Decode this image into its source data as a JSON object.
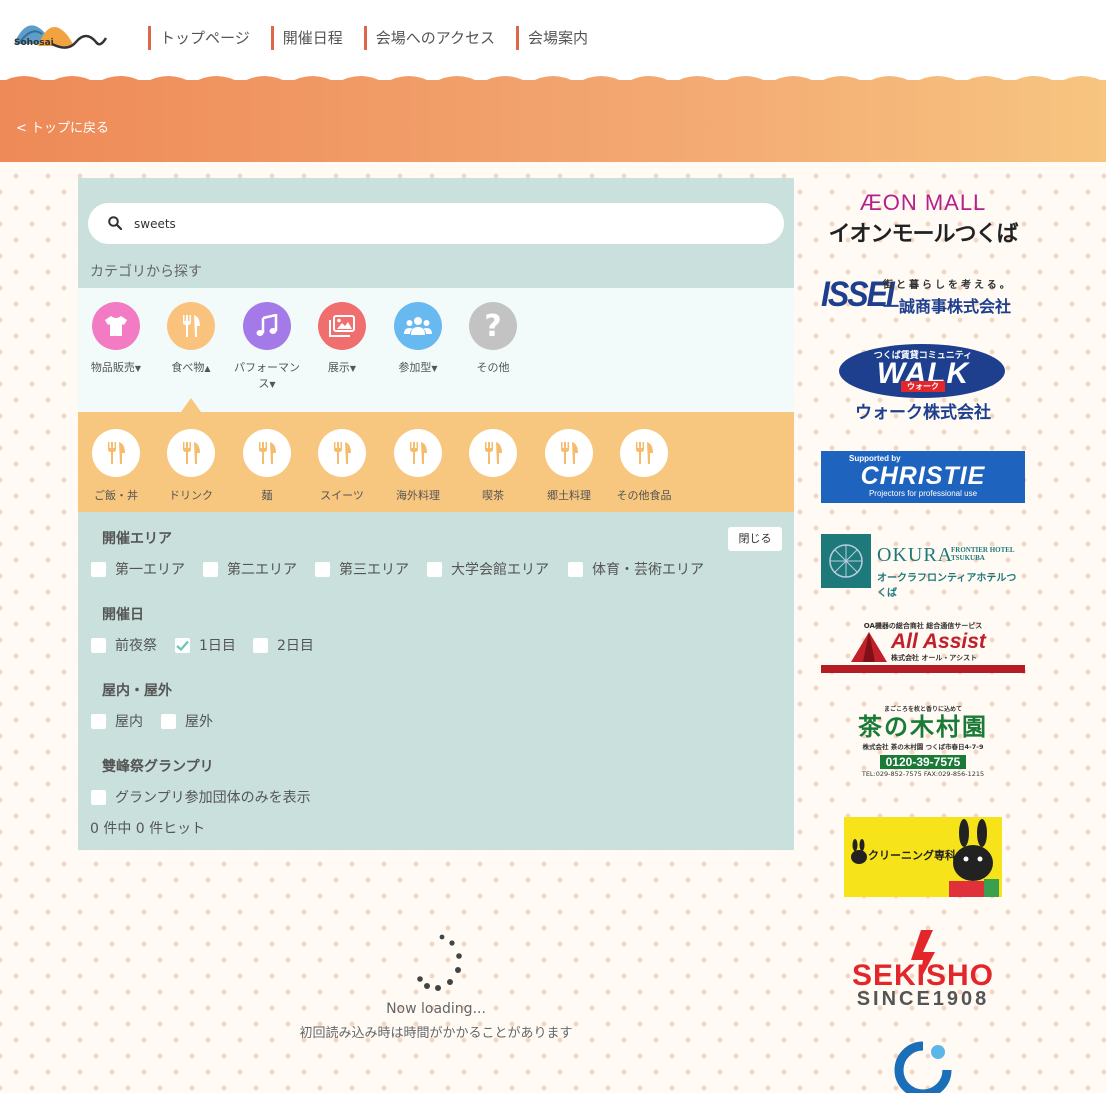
{
  "header": {
    "logo_text": "Sohosai",
    "nav": [
      "トップページ",
      "開催日程",
      "会場へのアクセス",
      "会場案内"
    ]
  },
  "banner": {
    "back_link": "< トップに戻る"
  },
  "search": {
    "value": "sweets"
  },
  "categories": {
    "heading": "カテゴリから探す",
    "items": [
      {
        "label": "物品販売",
        "color": "#f27bc4",
        "icon": "tshirt-icon"
      },
      {
        "label": "食べ物",
        "color": "#f9c37d",
        "icon": "utensils-icon"
      },
      {
        "label": "パフォーマンス",
        "color": "#a47ae8",
        "icon": "music-note-icon"
      },
      {
        "label": "展示",
        "color": "#f06e6e",
        "icon": "images-icon"
      },
      {
        "label": "参加型",
        "color": "#69b9f1",
        "icon": "people-icon"
      },
      {
        "label": "その他",
        "color": "#c3c3c3",
        "icon": "question-icon"
      }
    ],
    "sub_items": [
      "ご飯・丼",
      "ドリンク",
      "麺",
      "スイーツ",
      "海外料理",
      "喫茶",
      "郷土料理",
      "その他食品"
    ]
  },
  "filters": {
    "close_label": "閉じる",
    "area": {
      "title": "開催エリア",
      "options": [
        "第一エリア",
        "第二エリア",
        "第三エリア",
        "大学会館エリア",
        "体育・芸術エリア"
      ]
    },
    "date": {
      "title": "開催日",
      "options": [
        {
          "label": "前夜祭",
          "checked": false
        },
        {
          "label": "1日目",
          "checked": true
        },
        {
          "label": "2日目",
          "checked": false
        }
      ]
    },
    "place": {
      "title": "屋内・屋外",
      "options": [
        "屋内",
        "屋外"
      ]
    },
    "grandprix": {
      "title": "雙峰祭グランプリ",
      "option": "グランプリ参加団体のみを表示"
    }
  },
  "hits": "0 件中 0 件ヒット",
  "loading": {
    "text": "Now loading...",
    "note": "初回読み込み時は時間がかかることがあります"
  },
  "sponsors": {
    "aeon": {
      "line1": "ÆON MALL",
      "line2": "イオンモールつくば"
    },
    "issei": {
      "name": "ISSEI",
      "tagline": "街と暮らしを考える。",
      "company": "一誠商事株式会社"
    },
    "walk": {
      "tagline": "つくば賃貸コミュニティ",
      "name": "WALK",
      "kana": "ウォーク",
      "company": "ウォーク株式会社"
    },
    "christie": {
      "top": "Supported by",
      "name": "CHRISTIE",
      "sub": "Projectors for professional use"
    },
    "okura": {
      "name": "OKURA",
      "sub": "FRONTIER HOTEL TSUKUBA",
      "jp": "オークラフロンティアホテルつくば"
    },
    "allassist": {
      "top": "OA機器の総合商社 総合通信サービス",
      "name": "All Assist",
      "company": "株式会社 オール・アシスト"
    },
    "kimura": {
      "top": "まごころを枚と香りに込めて",
      "name": "茶の木村園",
      "addr": "株式会社 茶の木村園 つくば市春日4-7-9",
      "tel": "0120-39-7575",
      "fax": "TEL:029-852-7575 FAX:029-856-1215"
    },
    "cleaning": {
      "text": "クリーニング専科"
    },
    "sekisho": {
      "name": "SEKISHO",
      "since": "SINCE1908"
    }
  }
}
